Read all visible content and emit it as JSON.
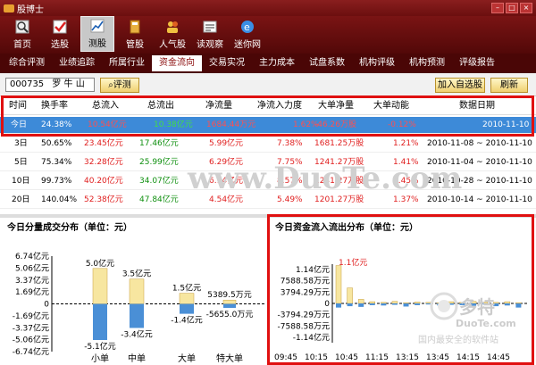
{
  "app": {
    "title": "股博士"
  },
  "toolbar": [
    {
      "label": "首页",
      "icon": "home-icon"
    },
    {
      "label": "选股",
      "icon": "checklist-icon"
    },
    {
      "label": "测股",
      "icon": "chart-icon",
      "active": true
    },
    {
      "label": "管股",
      "icon": "book-icon"
    },
    {
      "label": "人气股",
      "icon": "people-icon"
    },
    {
      "label": "读观察",
      "icon": "eye-icon"
    },
    {
      "label": "迷你网",
      "icon": "browser-icon"
    }
  ],
  "tabs": [
    "综合评测",
    "业绩追踪",
    "所属行业",
    "资金流向",
    "交易实况",
    "主力成本",
    "试盘系数",
    "机构评级",
    "机构预测",
    "评级报告"
  ],
  "active_tab": "资金流向",
  "stock": {
    "code": "000735",
    "name": "罗 牛 山"
  },
  "buttons": {
    "test": "评测",
    "add": "加入自选股",
    "refresh": "刷新"
  },
  "columns": [
    "时间",
    "换手率",
    "总流入",
    "总流出",
    "净流量",
    "净流入力度",
    "大单净量",
    "大单动能",
    "数据日期"
  ],
  "rows": [
    {
      "period": "今日",
      "turnover": "24.38%",
      "inflow": "10.54亿元",
      "outflow": "10.38亿元",
      "net": "1684.44万元",
      "strength": "1.62%",
      "large_net": "-46.26万股",
      "momentum": "-0.12%",
      "date": "2010-11-10"
    },
    {
      "period": "3日",
      "turnover": "50.65%",
      "inflow": "23.45亿元",
      "outflow": "17.46亿元",
      "net": "5.99亿元",
      "strength": "7.38%",
      "large_net": "1681.25万股",
      "momentum": "1.21%",
      "date": "2010-11-08 ~ 2010-11-10"
    },
    {
      "period": "5日",
      "turnover": "75.34%",
      "inflow": "32.28亿元",
      "outflow": "25.99亿元",
      "net": "6.29亿元",
      "strength": "7.75%",
      "large_net": "1241.27万股",
      "momentum": "1.41%",
      "date": "2010-11-04 ~ 2010-11-10"
    },
    {
      "period": "10日",
      "turnover": "99.73%",
      "inflow": "40.20亿元",
      "outflow": "34.07亿元",
      "net": "6.14亿元",
      "strength": "8.57%",
      "large_net": "1241.27万股",
      "momentum": "1.45%",
      "date": "2010-10-28 ~ 2010-11-10"
    },
    {
      "period": "20日",
      "turnover": "140.04%",
      "inflow": "52.38亿元",
      "outflow": "47.84亿元",
      "net": "4.54亿元",
      "strength": "5.49%",
      "large_net": "1201.27万股",
      "momentum": "1.37%",
      "date": "2010-10-14 ~ 2010-11-10"
    }
  ],
  "left_panel": {
    "title": "今日分量成交分布（单位：元）"
  },
  "right_panel": {
    "title": "今日资金流入流出分布（单位：元）"
  },
  "watermarks": {
    "center": "www.DuoTe.com",
    "brand": "多特",
    "site": "DuoTe.com",
    "slogan": "国内最安全的软件站"
  },
  "colors": {
    "inflow": "#f7e6a0",
    "outflow": "#4a8fd6",
    "highlight": "#e01010",
    "selected_row": "#3d8ad8"
  },
  "chart_data": [
    {
      "type": "bar",
      "title": "今日分量成交分布（单位：元）",
      "yticks": [
        "6.74亿元",
        "5.06亿元",
        "3.37亿元",
        "1.69亿元",
        "0",
        "-1.69亿元",
        "-3.37亿元",
        "-5.06亿元",
        "-6.74亿元"
      ],
      "ylim": [
        -6.74,
        6.74
      ],
      "categories": [
        "小单",
        "中单",
        "大单",
        "特大单"
      ],
      "series": [
        {
          "values": [
            5.0,
            3.5,
            1.5,
            0.5389
          ]
        },
        {
          "values": [
            -5.1,
            -3.4,
            -1.4,
            -0.5655
          ]
        }
      ],
      "data_labels": {
        "positive": [
          "5.0亿元",
          "3.5亿元",
          "1.5亿元",
          "5389.5万元"
        ],
        "negative": [
          "-5.1亿元",
          "-3.4亿元",
          "-1.4亿元",
          "-5655.0万元"
        ]
      }
    },
    {
      "type": "bar",
      "title": "今日资金流入流出分布（单位：元）",
      "yticks": [
        "1.14亿元",
        "7588.58万元",
        "3794.29万元",
        "0",
        "-3794.29万元",
        "-7588.58万元",
        "-1.14亿元"
      ],
      "ylim": [
        -1.14,
        1.14
      ],
      "xticks": [
        "09:45",
        "10:15",
        "10:45",
        "11:15",
        "13:15",
        "13:45",
        "14:15",
        "14:45"
      ],
      "peak_label": "1.1亿元",
      "series": [
        {
          "values": [
            1.1,
            0.45,
            0.12,
            0.05,
            0.03,
            0.06,
            0.02,
            0.04,
            0.03,
            0.02,
            0.05,
            0.03,
            0.06,
            0.04,
            0.03,
            0.05,
            0.02
          ]
        },
        {
          "values": [
            -0.12,
            -0.08,
            -0.1,
            -0.05,
            -0.06,
            -0.04,
            -0.09,
            -0.05,
            -0.03,
            -0.06,
            -0.04,
            -0.05,
            -0.07,
            -0.03,
            -0.08,
            -0.06,
            -0.12
          ]
        }
      ]
    }
  ]
}
